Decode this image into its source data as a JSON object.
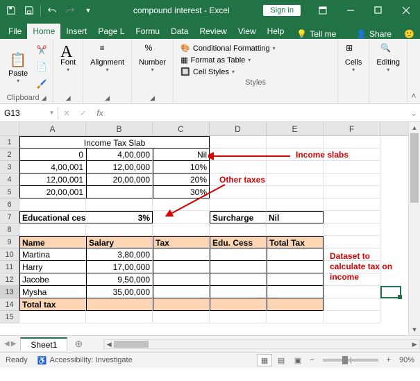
{
  "titlebar": {
    "title": "compound interest - Excel",
    "signin": "Sign in"
  },
  "tabs": {
    "file": "File",
    "home": "Home",
    "insert": "Insert",
    "pageLayout": "Page L",
    "formulas": "Formu",
    "data": "Data",
    "review": "Review",
    "view": "View",
    "help": "Help",
    "tellMe": "Tell me",
    "share": "Share"
  },
  "ribbon": {
    "paste": "Paste",
    "clipboard": "Clipboard",
    "font": "Font",
    "alignment": "Alignment",
    "number": "Number",
    "condFmt": "Conditional Formatting",
    "fmtTable": "Format as Table",
    "cellStyles": "Cell Styles",
    "styles": "Styles",
    "cells": "Cells",
    "editing": "Editing"
  },
  "formulaBar": {
    "nameBox": "G13",
    "formula": ""
  },
  "columns": [
    "A",
    "B",
    "C",
    "D",
    "E",
    "F"
  ],
  "rows": [
    1,
    2,
    3,
    4,
    5,
    6,
    7,
    8,
    9,
    10,
    11,
    12,
    13,
    14,
    15
  ],
  "cells": {
    "title_slab": "Income Tax Slab",
    "r2a": "0",
    "r2b": "4,00,000",
    "r2c": "Nil",
    "r3a": "4,00,001",
    "r3b": "12,00,000",
    "r3c": "10%",
    "r4a": "12,00,001",
    "r4b": "20,00,000",
    "r4c": "20%",
    "r5a": "20,00,001",
    "r5c": "30%",
    "r7a": "Educational cess",
    "r7b": "3%",
    "r7d": "Surcharge",
    "r7e": "Nil",
    "r9a": "Name",
    "r9b": "Salary",
    "r9c": "Tax",
    "r9d": "Edu. Cess",
    "r9e": "Total Tax",
    "r10a": "Martina",
    "r10b": "3,80,000",
    "r11a": "Harry",
    "r11b": "17,00,000",
    "r12a": "Jacobe",
    "r12b": "9,50,000",
    "r13a": "Mysha",
    "r13b": "35,00,000",
    "r14a": "Total tax"
  },
  "annotations": {
    "incomeSlabs": "Income slabs",
    "otherTaxes": "Other taxes",
    "dataset": "Dataset to calculate tax on income"
  },
  "sheetTabs": {
    "sheet1": "Sheet1"
  },
  "statusBar": {
    "ready": "Ready",
    "accessibility": "Accessibility: Investigate",
    "zoom": "90%"
  }
}
